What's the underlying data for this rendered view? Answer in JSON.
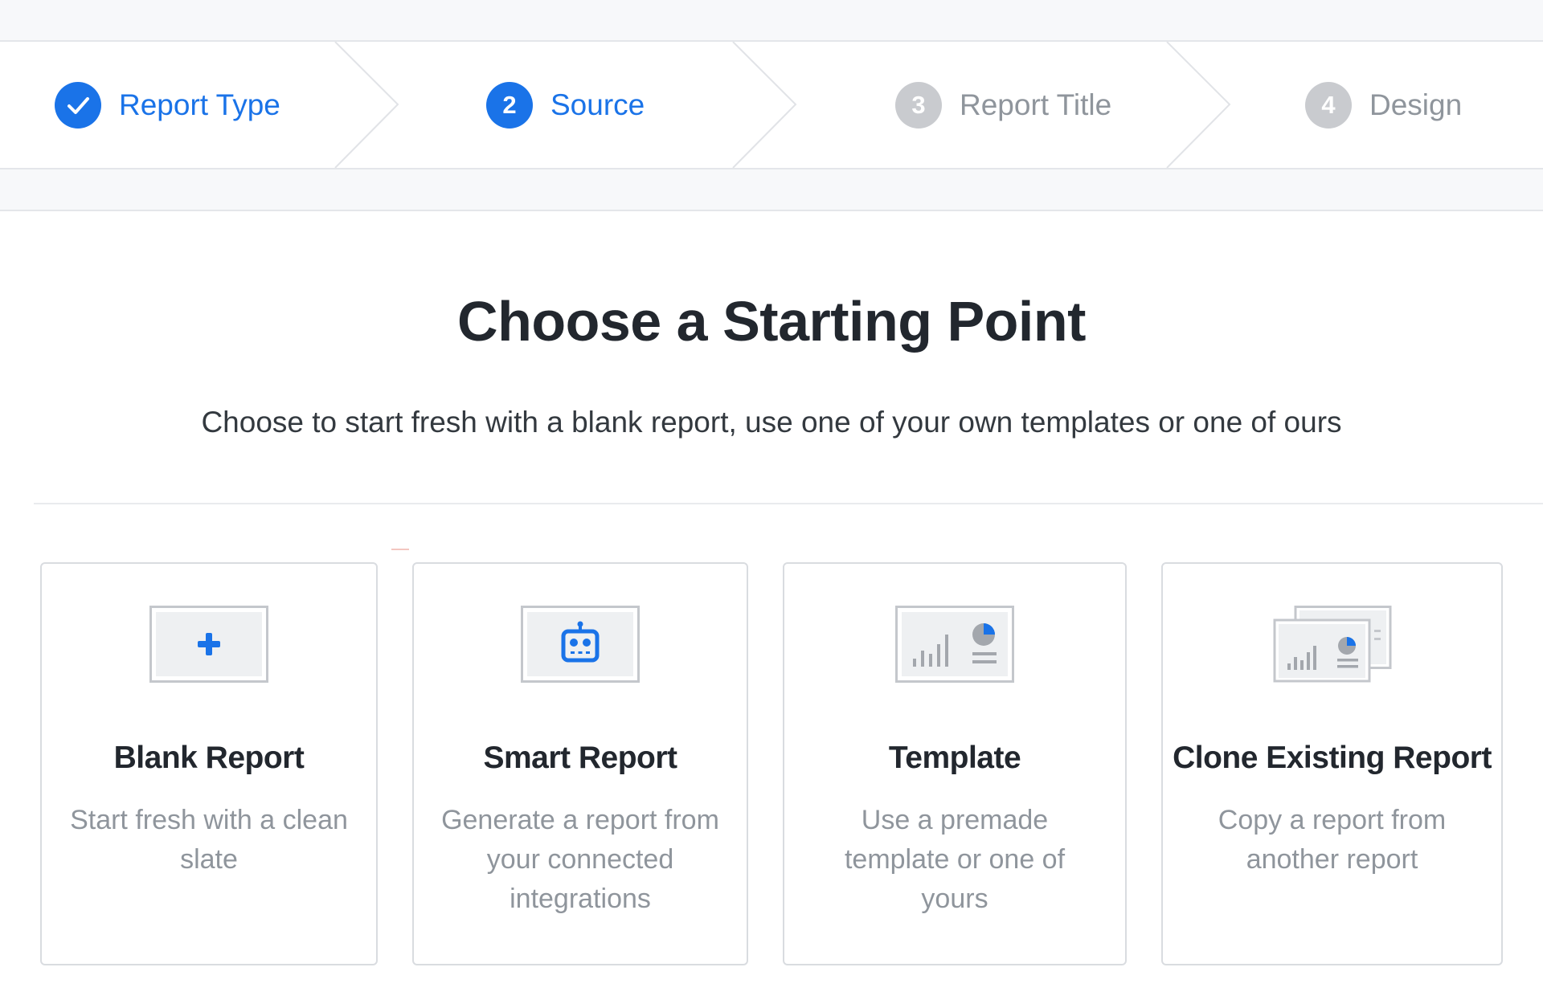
{
  "stepper": {
    "steps": [
      {
        "number": "",
        "label": "Report Type",
        "state": "completed"
      },
      {
        "number": "2",
        "label": "Source",
        "state": "active"
      },
      {
        "number": "3",
        "label": "Report Title",
        "state": "inactive"
      },
      {
        "number": "4",
        "label": "Design",
        "state": "inactive"
      }
    ]
  },
  "main": {
    "title": "Choose a Starting Point",
    "subtitle": "Choose to start fresh with a blank report, use one of your own templates or one of ours"
  },
  "cards": [
    {
      "title": "Blank Report",
      "description": "Start fresh with a clean slate",
      "icon": "plus-icon"
    },
    {
      "title": "Smart Report",
      "description": "Generate a report from your connected integrations",
      "icon": "robot-icon"
    },
    {
      "title": "Template",
      "description": "Use a premade template or one of yours",
      "icon": "template-chart-icon"
    },
    {
      "title": "Clone Existing Report",
      "description": "Copy a report from another report",
      "icon": "clone-report-icon"
    }
  ],
  "colors": {
    "accent": "#1a73e8",
    "inactive": "#c9cbcf",
    "muted_text": "#8f959c",
    "heading": "#22272e"
  }
}
